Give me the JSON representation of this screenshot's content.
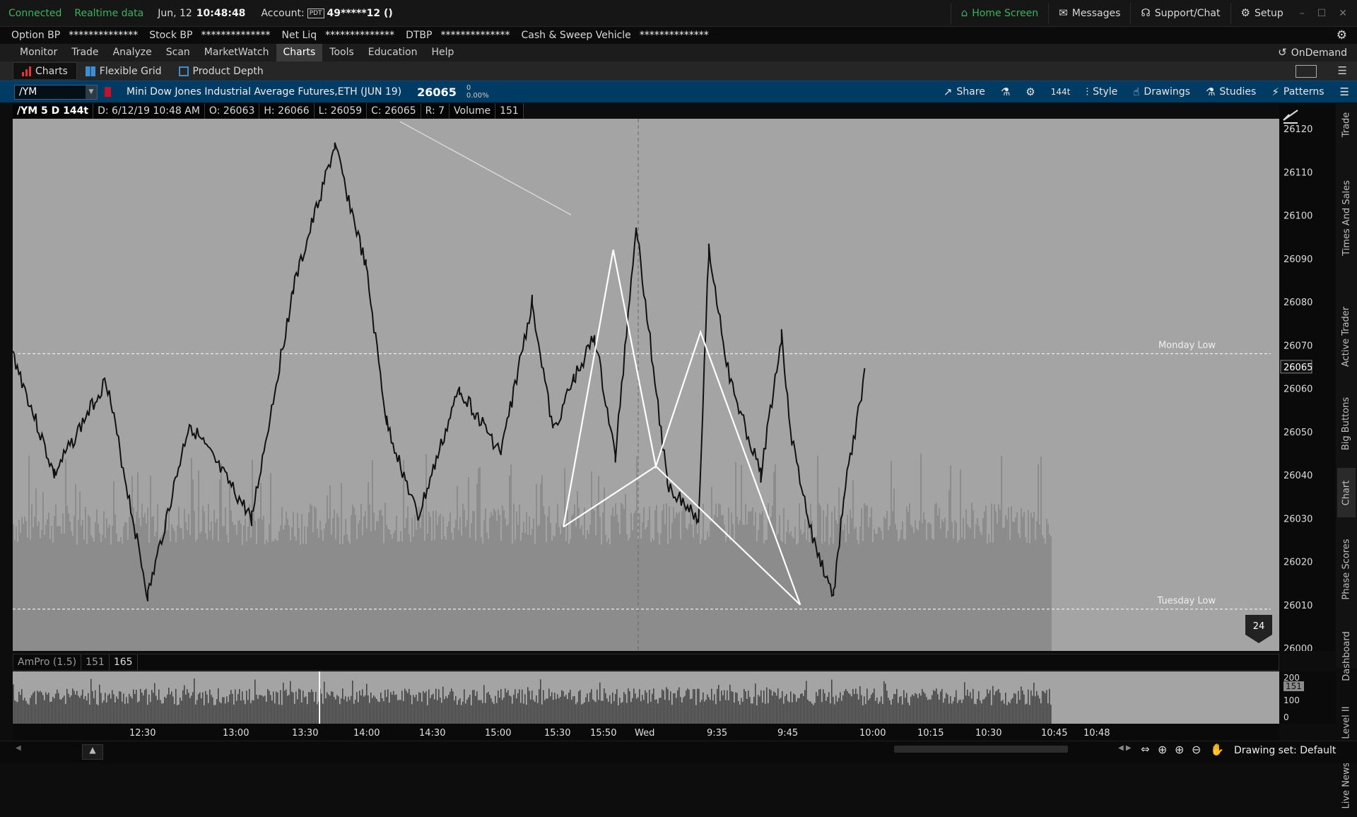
{
  "status": {
    "connected": "Connected",
    "realtime": "Realtime data",
    "date": "Jun, 12",
    "time": "10:48:48",
    "account_label": "Account:",
    "pdt": "PDT",
    "account_value": "49*****12 ()",
    "home_screen": "Home Screen",
    "messages": "Messages",
    "support_chat": "Support/Chat",
    "setup": "Setup"
  },
  "bpbar": {
    "option_bp_label": "Option BP",
    "option_bp_value": "**************",
    "stock_bp_label": "Stock BP",
    "stock_bp_value": "**************",
    "net_liq_label": "Net Liq",
    "net_liq_value": "**************",
    "dtbp_label": "DTBP",
    "dtbp_value": "**************",
    "cash_label": "Cash & Sweep Vehicle",
    "cash_value": "**************"
  },
  "menu": [
    "Monitor",
    "Trade",
    "Analyze",
    "Scan",
    "MarketWatch",
    "Charts",
    "Tools",
    "Education",
    "Help"
  ],
  "menu_active": "Charts",
  "ondemand": "OnDemand",
  "subtabs": {
    "charts": "Charts",
    "flexible_grid": "Flexible Grid",
    "product_depth": "Product Depth"
  },
  "symbar": {
    "symbol": "/YM",
    "description": "Mini Dow Jones Industrial Average Futures,ETH (JUN 19)",
    "last": "26065",
    "change": "0",
    "change_pct": "0.00%",
    "share": "Share",
    "aggregation": "144t",
    "style": "Style",
    "drawings": "Drawings",
    "studies": "Studies",
    "patterns": "Patterns"
  },
  "infobar": {
    "title": "/YM 5 D 144t",
    "date": "D: 6/12/19 10:48 AM",
    "open": "O: 26063",
    "high": "H: 26066",
    "low": "L: 26059",
    "close": "C: 26065",
    "range": "R: 7",
    "volume_label": "Volume",
    "volume": "151"
  },
  "chart_data": {
    "type": "line",
    "symbol": "/YM",
    "ylim": [
      26000,
      26125
    ],
    "y_ticks": [
      "26120",
      "26110",
      "26100",
      "26090",
      "26080",
      "26070",
      "26060",
      "26050",
      "26040",
      "26030",
      "26020",
      "26010",
      "26000"
    ],
    "x_ticks": [
      "12:30",
      "13:00",
      "13:30",
      "14:00",
      "14:30",
      "15:00",
      "15:30",
      "15:50",
      "Wed",
      "9:35",
      "9:45",
      "10:00",
      "10:15",
      "10:30",
      "10:45",
      "10:48"
    ],
    "x": [
      0,
      0.04,
      0.09,
      0.13,
      0.17,
      0.23,
      0.27,
      0.31,
      0.34,
      0.36,
      0.39,
      0.43,
      0.47,
      0.5,
      0.52,
      0.54,
      0.56,
      0.58,
      0.6,
      0.63,
      0.66,
      0.67,
      0.69,
      0.72,
      0.74,
      0.75,
      0.77,
      0.79,
      0.8,
      0.82
    ],
    "y": [
      26068,
      26040,
      26062,
      26012,
      26052,
      26030,
      26083,
      26116,
      26088,
      26052,
      26030,
      26060,
      26045,
      26080,
      26050,
      26062,
      26072,
      26044,
      26098,
      26038,
      26030,
      26092,
      26062,
      26040,
      26072,
      26048,
      26025,
      26012,
      26035,
      26063
    ],
    "horizontal_lines": [
      {
        "name": "Monday Low",
        "value": 26068
      },
      {
        "name": "Tuesday Low",
        "value": 26009
      }
    ],
    "pattern_points": [
      [
        0.53,
        26028
      ],
      [
        0.578,
        26092
      ],
      [
        0.619,
        26042
      ],
      [
        0.662,
        26073
      ],
      [
        0.758,
        26010
      ]
    ],
    "current_price_label": "26065",
    "bar_count_badge": "24"
  },
  "volume_study": {
    "name": "AmPro (1.5)",
    "value1": "151",
    "value2": "165",
    "axis_label_top": "200",
    "axis_label_current": "151",
    "axis_label_mid": "100",
    "axis_label_bottom": "0"
  },
  "side_tabs": [
    "Trade",
    "Times And Sales",
    "Active Trader",
    "Big Buttons",
    "Chart",
    "Phase Scores",
    "Dashboard",
    "Level II",
    "Live News"
  ],
  "bottom": {
    "drawing_set": "Drawing set: Default"
  }
}
